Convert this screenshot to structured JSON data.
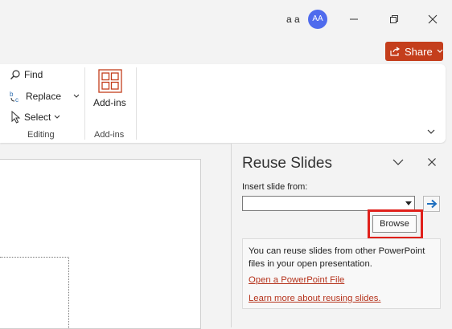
{
  "titlebar": {
    "user_name": "a a",
    "avatar_initials": "AA"
  },
  "share": {
    "label": "Share",
    "color": "#c43e1c"
  },
  "ribbon": {
    "editing": {
      "find_label": "Find",
      "replace_label": "Replace",
      "select_label": "Select",
      "group_label": "Editing"
    },
    "addins": {
      "button_label": "Add-ins",
      "group_label": "Add-ins"
    }
  },
  "reuse_pane": {
    "title": "Reuse Slides",
    "insert_label": "Insert slide from:",
    "combo_value": "",
    "browse_label": "Browse",
    "info_text": "You can reuse slides from other PowerPoint files in your open presentation.",
    "link_open": "Open a PowerPoint File",
    "link_learn": "Learn more about reusing slides."
  },
  "colors": {
    "accent": "#c43e1c",
    "highlight": "#e0201b",
    "avatar": "#4f6bed"
  }
}
